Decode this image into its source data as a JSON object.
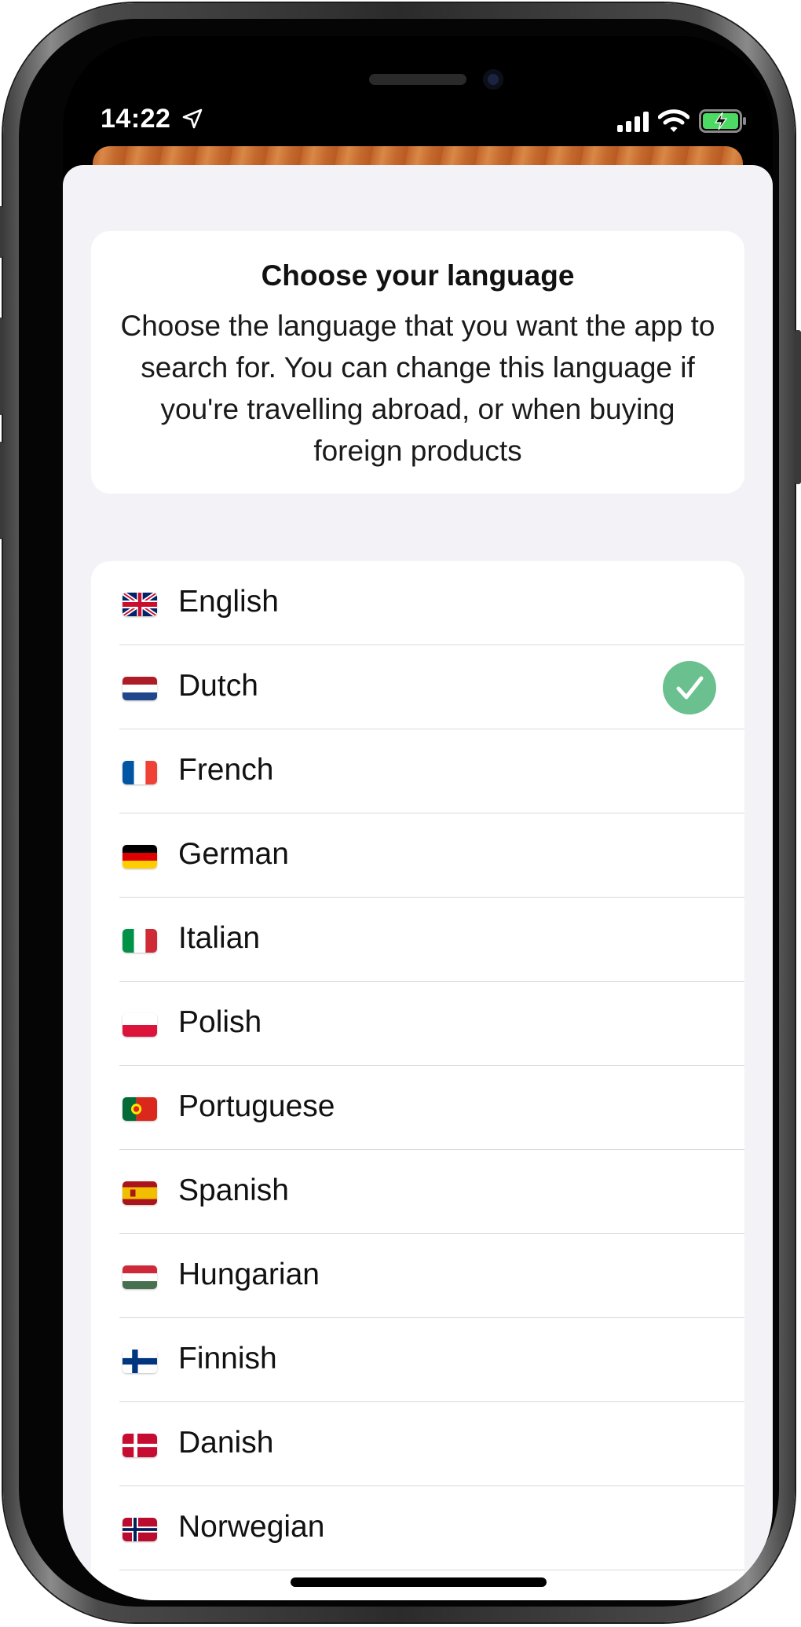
{
  "status_bar": {
    "time": "14:22",
    "icons": [
      "location-arrow-icon",
      "cellular-signal-icon",
      "wifi-icon",
      "battery-charging-icon"
    ],
    "battery_color": "#4cd964"
  },
  "intro": {
    "title": "Choose your language",
    "description": "Choose the language that you want the app to search for. You can change this language if you're travelling abroad, or when buying foreign products"
  },
  "languages": {
    "selected": "Dutch",
    "accent_color": "#6ac08f",
    "items": [
      {
        "label": "English",
        "flag": "gb-flag-icon"
      },
      {
        "label": "Dutch",
        "flag": "nl-flag-icon",
        "selected": true
      },
      {
        "label": "French",
        "flag": "fr-flag-icon"
      },
      {
        "label": "German",
        "flag": "de-flag-icon"
      },
      {
        "label": "Italian",
        "flag": "it-flag-icon"
      },
      {
        "label": "Polish",
        "flag": "pl-flag-icon"
      },
      {
        "label": "Portuguese",
        "flag": "pt-flag-icon"
      },
      {
        "label": "Spanish",
        "flag": "es-flag-icon"
      },
      {
        "label": "Hungarian",
        "flag": "hu-flag-icon"
      },
      {
        "label": "Finnish",
        "flag": "fi-flag-icon"
      },
      {
        "label": "Danish",
        "flag": "dk-flag-icon"
      },
      {
        "label": "Norwegian",
        "flag": "no-flag-icon"
      }
    ]
  }
}
